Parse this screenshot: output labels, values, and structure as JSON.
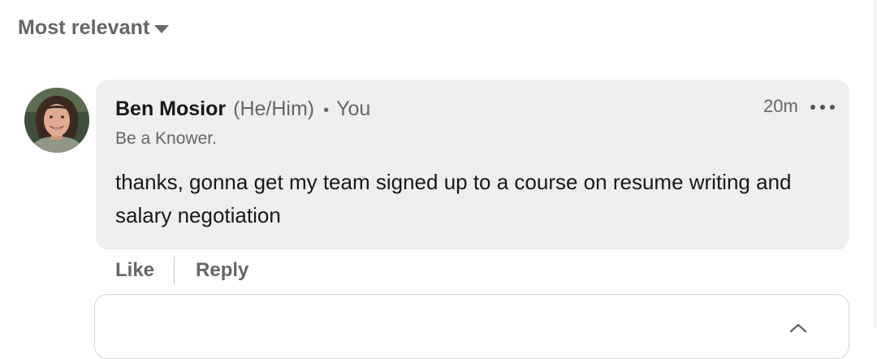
{
  "sort": {
    "label": "Most relevant",
    "icon": "caret-down-icon"
  },
  "comment": {
    "author": "Ben Mosior",
    "pronouns": "(He/Him)",
    "separator": "•",
    "relation": "You",
    "headline": "Be a Knower.",
    "timestamp": "20m",
    "text": "thanks, gonna get my team signed up to a course on resume writing and salary negotiation",
    "bubble_color": "#efefef"
  },
  "actions": {
    "like_label": "Like",
    "reply_label": "Reply"
  }
}
